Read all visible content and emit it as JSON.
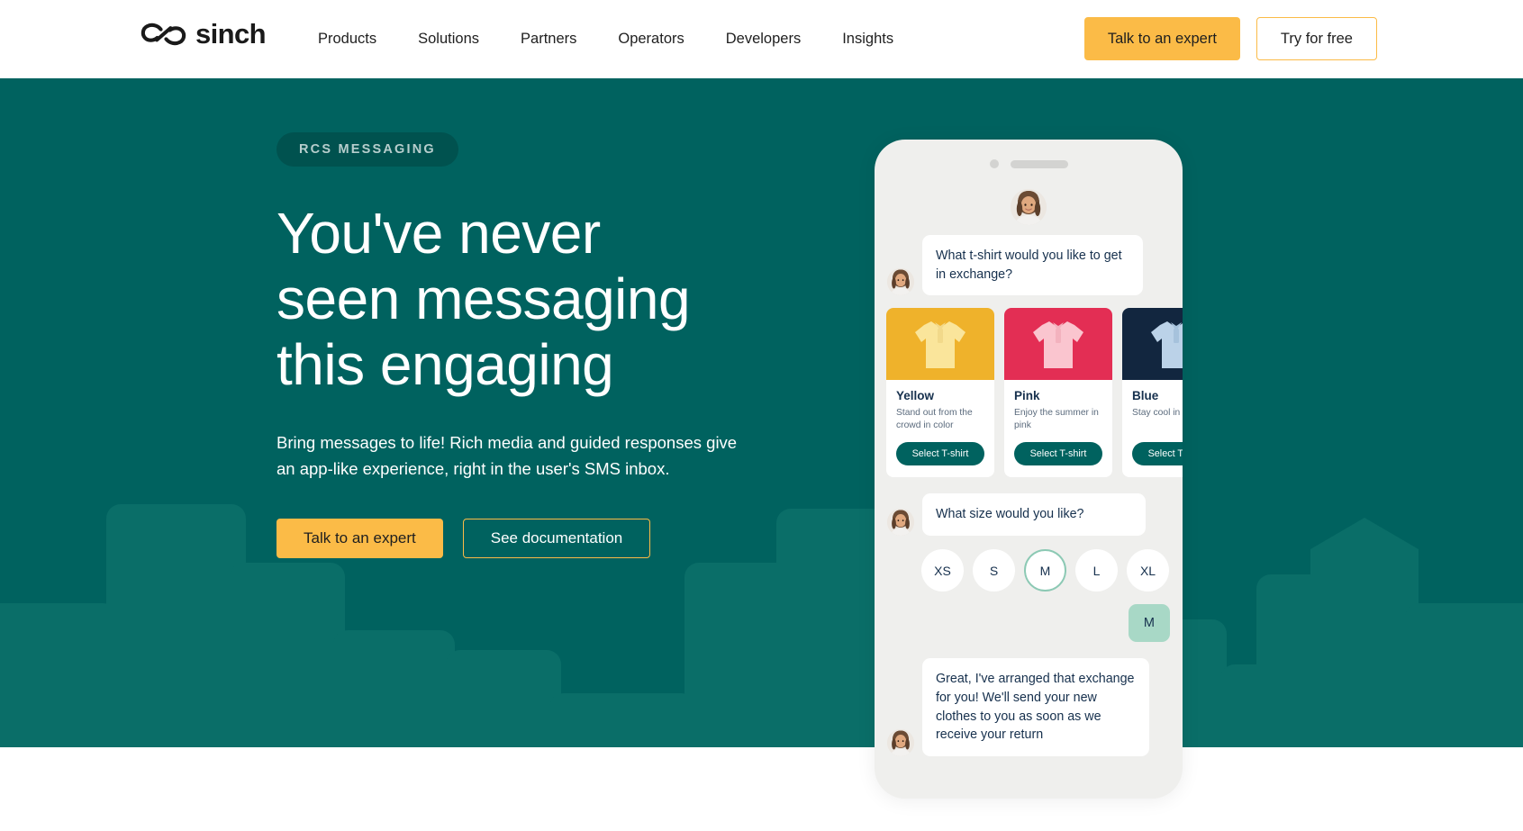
{
  "header": {
    "logo_text": "sinch",
    "logo_icon": "sinch-infinity-logo",
    "nav": [
      {
        "label": "Products"
      },
      {
        "label": "Solutions"
      },
      {
        "label": "Partners"
      },
      {
        "label": "Operators"
      },
      {
        "label": "Developers"
      },
      {
        "label": "Insights"
      }
    ],
    "talk_button": "Talk to an expert",
    "try_button": "Try for free"
  },
  "hero": {
    "badge": "RCS MESSAGING",
    "headline_lines": [
      "You've never",
      "seen messaging",
      "this engaging"
    ],
    "headline_full": "You've never seen messaging this engaging",
    "subtext": "Bring messages to life! Rich media and guided responses give an app-like experience, right in the user's SMS inbox.",
    "cta_primary": "Talk to an expert",
    "cta_secondary": "See documentation",
    "background_color": "#00625F",
    "skyline_color": "#0A6E68",
    "accent_color": "#FBBB47"
  },
  "phone": {
    "chat": {
      "agent_message_1": "What t-shirt would you like to get in exchange?",
      "agent_message_2": "What size would you like?",
      "user_reply": "M",
      "agent_message_3": "Great, I've arranged that exchange for you! We'll send your new clothes to you as soon as we receive your return",
      "cards": [
        {
          "title": "Yellow",
          "description": "Stand out from the crowd in color",
          "button": "Select T-shirt",
          "bg_color": "#EFB22B",
          "shirt_color": "#FAE59B"
        },
        {
          "title": "Pink",
          "description": "Enjoy the summer in pink",
          "button": "Select T-shirt",
          "bg_color": "#E32E54",
          "shirt_color": "#FAC5CF"
        },
        {
          "title": "Blue",
          "description": "Stay cool in blue",
          "button": "Select T-shirt",
          "bg_color": "#12263F",
          "shirt_color": "#BBD2E8"
        }
      ],
      "sizes": [
        {
          "label": "XS",
          "selected": false
        },
        {
          "label": "S",
          "selected": false
        },
        {
          "label": "M",
          "selected": true
        },
        {
          "label": "L",
          "selected": false
        },
        {
          "label": "XL",
          "selected": false
        }
      ]
    }
  }
}
